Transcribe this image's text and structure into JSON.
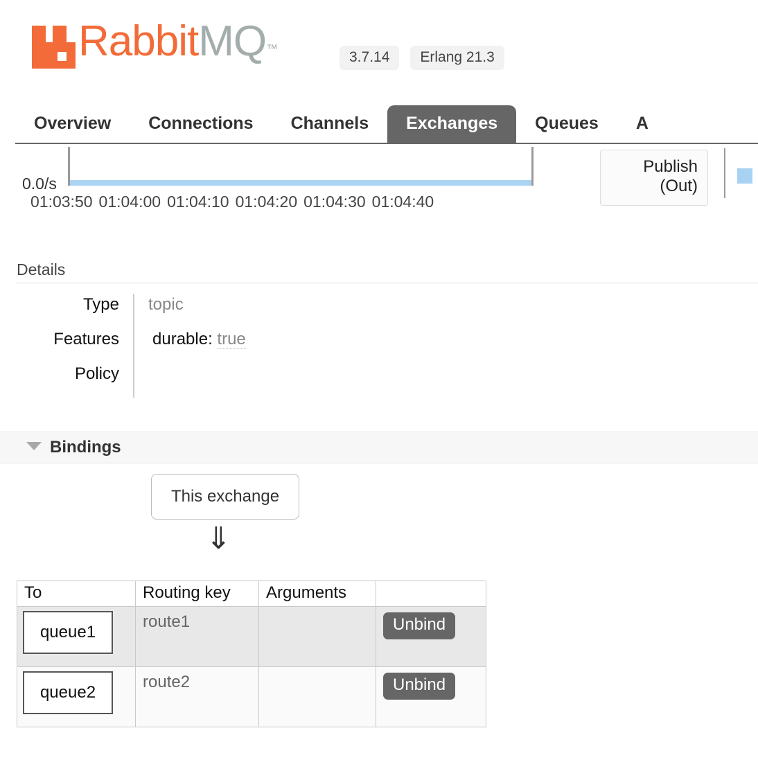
{
  "header": {
    "logo_text_primary": "Rabbit",
    "logo_text_secondary": "MQ",
    "logo_tm": "™",
    "version": "3.7.14",
    "erlang_version": "Erlang 21.3"
  },
  "nav": {
    "tabs": [
      {
        "label": "Overview",
        "active": false
      },
      {
        "label": "Connections",
        "active": false
      },
      {
        "label": "Channels",
        "active": false
      },
      {
        "label": "Exchanges",
        "active": true
      },
      {
        "label": "Queues",
        "active": false
      },
      {
        "label": "A",
        "active": false
      }
    ]
  },
  "chart_data": {
    "type": "line",
    "title": "",
    "xlabel": "",
    "ylabel": "0.0/s",
    "y_axis_label": "0.0/s",
    "x": [
      "01:03:50",
      "01:04:00",
      "01:04:10",
      "01:04:20",
      "01:04:30",
      "01:04:40"
    ],
    "series": [
      {
        "name": "Publish (Out)",
        "values": [
          0.0,
          0.0,
          0.0,
          0.0,
          0.0,
          0.0
        ],
        "color": "#a8d2f2"
      }
    ],
    "ylim": [
      0,
      1
    ],
    "grid": false,
    "legend_position": "right",
    "legend": [
      {
        "label": "Publish\n(Out)",
        "label_line1": "Publish",
        "label_line2": "(Out)",
        "color": "#a8d2f2"
      }
    ]
  },
  "details": {
    "title": "Details",
    "rows": [
      {
        "label": "Type",
        "value": "topic",
        "kind": "plain"
      },
      {
        "label": "Features",
        "value_prefix": "durable:",
        "value": "true",
        "kind": "feature"
      },
      {
        "label": "Policy",
        "value": "",
        "kind": "plain"
      }
    ]
  },
  "bindings": {
    "title": "Bindings",
    "source_label": "This exchange",
    "arrow_glyph": "⇓",
    "columns": [
      "To",
      "Routing key",
      "Arguments",
      ""
    ],
    "rows": [
      {
        "to": "queue1",
        "routing_key": "route1",
        "arguments": "",
        "action": "Unbind"
      },
      {
        "to": "queue2",
        "routing_key": "route2",
        "arguments": "",
        "action": "Unbind"
      }
    ]
  },
  "colors": {
    "brand_orange": "#f26b38",
    "brand_gray": "#a3adab",
    "active_tab": "#666666",
    "series_blue": "#a8d2f2",
    "button_gray": "#666666"
  }
}
